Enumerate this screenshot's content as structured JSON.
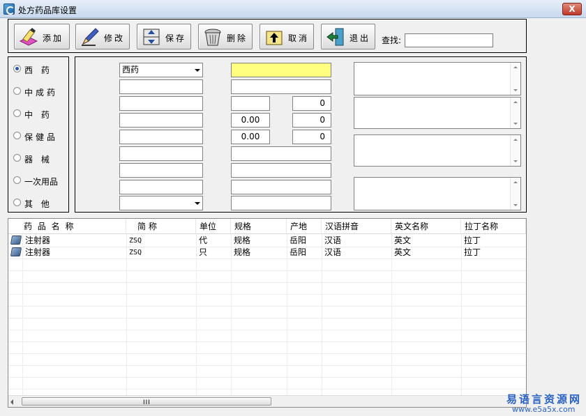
{
  "window": {
    "title": "处方药品库设置",
    "close_label": "X"
  },
  "toolbar": {
    "buttons": [
      {
        "id": "add",
        "label": "添加",
        "icon": "eraser-pencil-icon"
      },
      {
        "id": "edit",
        "label": "修改",
        "icon": "pen-icon"
      },
      {
        "id": "save",
        "label": "保存",
        "icon": "save-arrows-icon"
      },
      {
        "id": "delete",
        "label": "删除",
        "icon": "trash-bin-icon"
      },
      {
        "id": "cancel",
        "label": "取消",
        "icon": "undo-folder-icon"
      },
      {
        "id": "exit",
        "label": "退出",
        "icon": "exit-door-icon"
      }
    ],
    "search_label": "查找:",
    "search_value": ""
  },
  "categories": [
    {
      "label": "西  药",
      "checked": true
    },
    {
      "label": "中成药",
      "checked": false
    },
    {
      "label": "中  药",
      "checked": false
    },
    {
      "label": "保健品",
      "checked": false
    },
    {
      "label": "器  械",
      "checked": false
    },
    {
      "label": "一次用品",
      "checked": false
    },
    {
      "label": "其  他",
      "checked": false
    }
  ],
  "form": {
    "type_combo": "西药",
    "bottom_combo": "",
    "price1": "0.00",
    "price2": "0.00",
    "qty1": "0",
    "qty2": "0",
    "qty3": "0"
  },
  "grid": {
    "columns": [
      "药  品  名  称",
      "简  称",
      "单位",
      "规格",
      "产地",
      "汉语拼音",
      "英文名称",
      "拉丁名称"
    ],
    "rows": [
      [
        "注射器",
        "ZSQ",
        "代",
        "规格",
        "岳阳",
        "汉语",
        "英文",
        "拉丁"
      ],
      [
        "注射器",
        "ZSQ",
        "只",
        "规格",
        "岳阳",
        "汉语",
        "英文",
        "拉丁"
      ]
    ],
    "scroll_grip": "III"
  },
  "watermark": {
    "line1": "易语言资源网",
    "line2": "www.e5a5x.com"
  },
  "colors": {
    "highlight_field": "#ffff80",
    "watermark": "#2a62c4"
  }
}
